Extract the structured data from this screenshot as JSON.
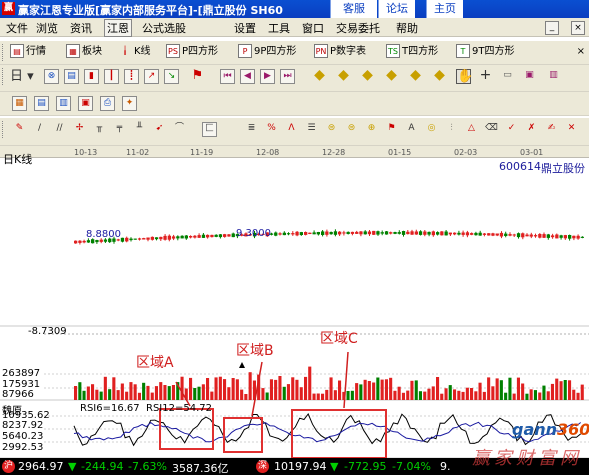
{
  "titlebar": {
    "app_icon_text": "赢",
    "title": "赢家江恩专业版[赢家内部服务平台]-[鼎立股份 SH60",
    "buttons": [
      "客服",
      "论坛",
      "主页"
    ]
  },
  "menu": [
    "文件",
    "浏览",
    "资讯",
    "江恩",
    "公式选股",
    "设置",
    "工具",
    "窗口",
    "交易委托",
    "帮助"
  ],
  "toolbar1": [
    {
      "icon": "quote-icon",
      "label": "行情"
    },
    {
      "icon": "sector-icon",
      "label": "板块"
    },
    {
      "icon": "kline-icon",
      "label": "K线"
    },
    {
      "icon": "p-square-icon",
      "label": "P四方形"
    },
    {
      "icon": "9p-square-icon",
      "label": "9P四方形"
    },
    {
      "icon": "pn-icon",
      "label": "P数字表"
    },
    {
      "icon": "t-square-icon",
      "label": "T四方形"
    },
    {
      "icon": "9t-square-icon",
      "label": "9T四方形"
    }
  ],
  "chart": {
    "kline_label": "日K线",
    "stock_code": "600614",
    "stock_name": "鼎立股份",
    "dates": [
      "10-13",
      "11-02",
      "11-19",
      "12-08",
      "12-28",
      "01-15",
      "02-03",
      "03-01"
    ],
    "price_labels": [
      "8.8800",
      "9.3000",
      "-8.7309"
    ],
    "volume_labels": [
      "263897",
      "175931",
      "87966"
    ],
    "rsi_panel_name": "魏原",
    "rsi_axis_labels": [
      "10935.62",
      "8237.92",
      "5640.23",
      "2992.53"
    ],
    "rsi6": "RSI6=16.67",
    "rsi12": "RSI12=54.72",
    "zones": [
      "区域A",
      "区域B",
      "区域C"
    ],
    "colors": {
      "up": "#e02020",
      "down": "#008000",
      "ma": "#1a1aa0",
      "zone": "#e03030"
    }
  },
  "statusbar": {
    "badge1": "沪",
    "index1": "2964.97",
    "chg1": "-244.94",
    "pct1": "-7.63%",
    "amt1": "3587.36亿",
    "badge2": "深",
    "index2": "10197.94",
    "chg2": "-772.95",
    "pct2": "-7.04%",
    "amt2": "9."
  },
  "watermark": {
    "logo": "gann",
    "logo_num": "360",
    "site": "赢家财富网"
  }
}
